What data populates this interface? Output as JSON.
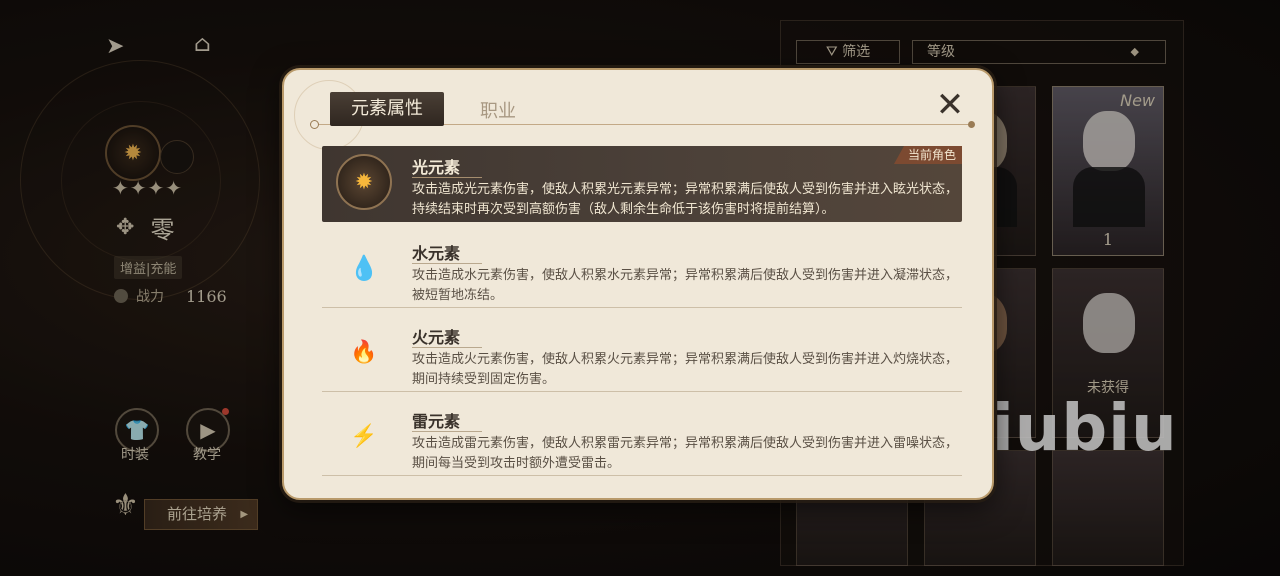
{
  "left_panel": {
    "character_name": "零",
    "stars": "✦✦✦✦",
    "role": "增益|充能",
    "power_label": "战力",
    "power_value": "1166",
    "fashion_label": "时装",
    "tutorial_label": "教学",
    "train_button": "前往培养",
    "icons": [
      "back-arrow-icon",
      "home-icon",
      "light-element-icon",
      "class-emblem-icon",
      "power-icon",
      "shirt-icon",
      "play-icon",
      "train-emblem-icon"
    ]
  },
  "roster": {
    "filter_label": "筛选",
    "sort_label": "等级",
    "cards": [
      {
        "tag": "",
        "count": ""
      },
      {
        "tag": "New",
        "count": "1"
      },
      {
        "tag": "",
        "count": ""
      },
      {
        "tag": "",
        "lock_label": "未获得"
      }
    ]
  },
  "watermark": "biubiu",
  "modal": {
    "tabs": [
      "元素属性",
      "职业"
    ],
    "active_tab": 0,
    "current_tag": "当前角色",
    "elements": [
      {
        "name": "光元素",
        "icon": "light-element-icon",
        "color": "#f6b73b",
        "description": "攻击造成光元素伤害，使敌人积累光元素异常；异常积累满后使敌人受到伤害并进入眩光状态，持续结束时再次受到高额伤害（敌人剩余生命低于该伤害时将提前结算）。",
        "current": true
      },
      {
        "name": "水元素",
        "icon": "water-element-icon",
        "color": "#6ab8e6",
        "description": "攻击造成水元素伤害，使敌人积累水元素异常；异常积累满后使敌人受到伤害并进入凝滞状态，被短暂地冻结。",
        "current": false
      },
      {
        "name": "火元素",
        "icon": "fire-element-icon",
        "color": "#e4566a",
        "description": "攻击造成火元素伤害，使敌人积累火元素异常；异常积累满后使敌人受到伤害并进入灼烧状态，期间持续受到固定伤害。",
        "current": false
      },
      {
        "name": "雷元素",
        "icon": "thunder-element-icon",
        "color": "#3ec6c0",
        "description": "攻击造成雷元素伤害，使敌人积累雷元素异常；异常积累满后使敌人受到伤害并进入雷噪状态，期间每当受到攻击时额外遭受雷击。",
        "current": false
      }
    ]
  }
}
